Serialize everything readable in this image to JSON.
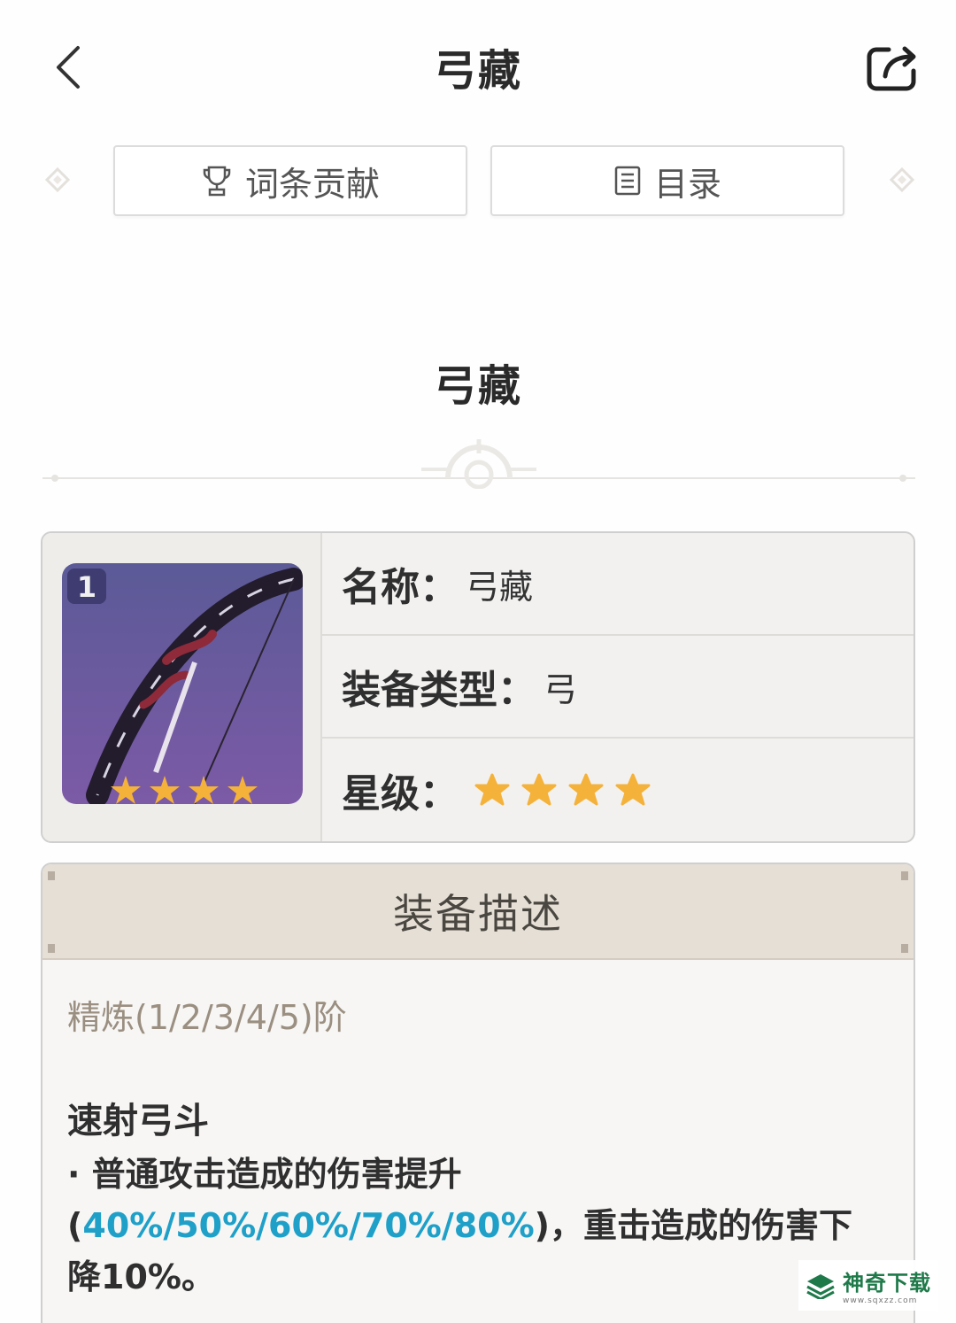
{
  "header": {
    "title": "弓藏",
    "back_icon": "back-arrow-icon",
    "share_icon": "share-icon"
  },
  "tabs": [
    {
      "label": "词条贡献",
      "icon": "trophy-icon"
    },
    {
      "label": "目录",
      "icon": "list-icon"
    }
  ],
  "section": {
    "title": "弓藏"
  },
  "info": {
    "thumbnail_badge": "1",
    "name_label": "名称：",
    "name_value": "弓藏",
    "type_label": "装备类型：",
    "type_value": "弓",
    "rarity_label": "星级：",
    "rarity_stars": 4
  },
  "description": {
    "header": "装备描述",
    "refine": "精炼(1/2/3/4/5)阶",
    "skill_name": "速射弓斗",
    "skill_prefix": "· 普通攻击造成的伤害提升(",
    "skill_highlight": "40%/50%/60%/70%/80%",
    "skill_suffix": ")，重击造成的伤害下降10%。"
  },
  "watermark": {
    "main": "神奇下载",
    "sub": "www.sqxzz.com"
  },
  "colors": {
    "highlight": "#1fa0c8",
    "star": "#f4b23a",
    "header_bg": "#e5dfd6"
  }
}
